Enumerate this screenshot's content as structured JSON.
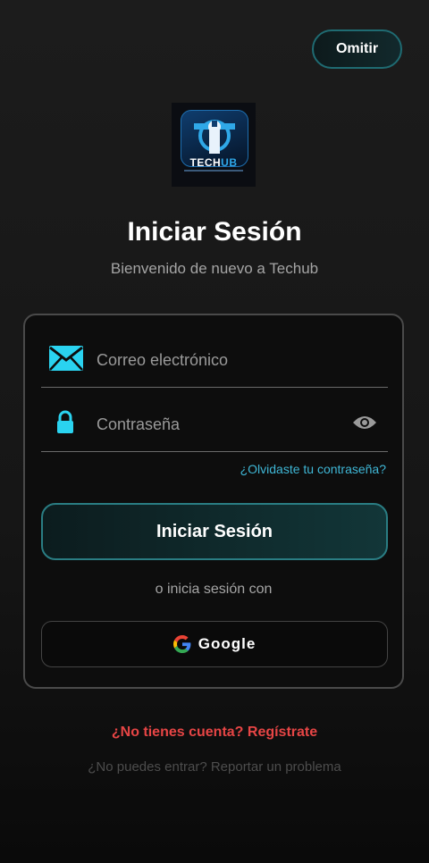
{
  "header": {
    "skip_label": "Omitir"
  },
  "logo": {
    "text_main": "TECH",
    "text_accent": "UB"
  },
  "title": "Iniciar Sesión",
  "subtitle": "Bienvenido de nuevo a Techub",
  "form": {
    "email_placeholder": "Correo electrónico",
    "password_placeholder": "Contraseña",
    "forgot_label": "¿Olvidaste tu contraseña?",
    "login_label": "Iniciar Sesión",
    "or_label": "o inicia sesión con",
    "google_label": "Google"
  },
  "footer": {
    "register_label": "¿No tienes cuenta? Regístrate",
    "report_label": "¿No puedes entrar? Reportar un problema"
  },
  "colors": {
    "accent": "#3fb7d6",
    "danger": "#e64545",
    "icon": "#2ad3f0"
  },
  "icons": {
    "email": "envelope-icon",
    "password": "lock-icon",
    "toggle": "eye-icon",
    "google": "google-icon"
  }
}
